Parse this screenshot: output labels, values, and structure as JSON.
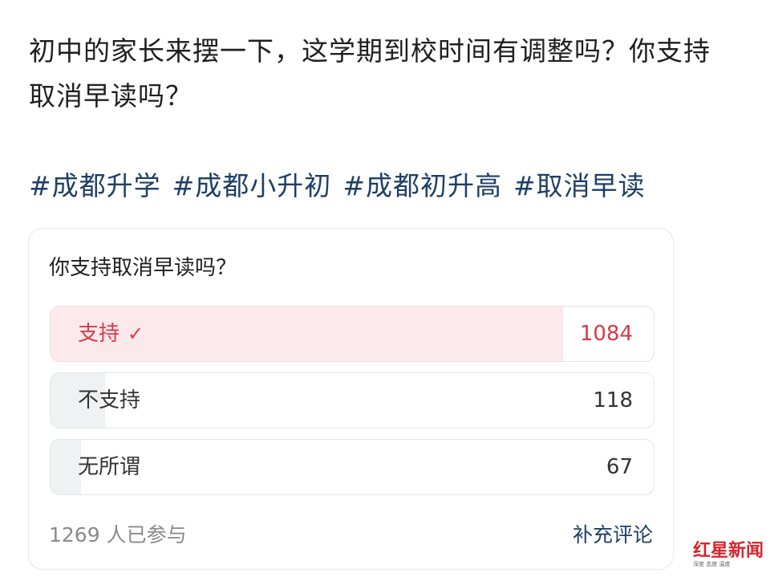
{
  "post": {
    "text": "初中的家长来摆一下，这学期到校时间有调整吗？你支持取消早读吗？",
    "hashtags": [
      "#成都升学",
      "#成都小升初",
      "#成都初升高",
      "#取消早读"
    ]
  },
  "poll": {
    "question": "你支持取消早读吗？",
    "options": [
      {
        "label": "支持",
        "count": "1084",
        "selected": true,
        "share": 0.85
      },
      {
        "label": "不支持",
        "count": "118",
        "selected": false,
        "share": 0.09
      },
      {
        "label": "无所谓",
        "count": "67",
        "selected": false,
        "share": 0.05
      }
    ],
    "participants": "1269 人已参与",
    "add_comment": "补充评论"
  },
  "watermark": {
    "brand": "红星新闻",
    "tagline": "深度 态度 温度"
  },
  "colors": {
    "hashtag": "#1e3f66",
    "selected_accent": "#d93a4a",
    "selected_fill": "#fce9eb",
    "option_fill": "#f0f1f3"
  },
  "icons": {
    "selected_mark": "check-icon"
  }
}
